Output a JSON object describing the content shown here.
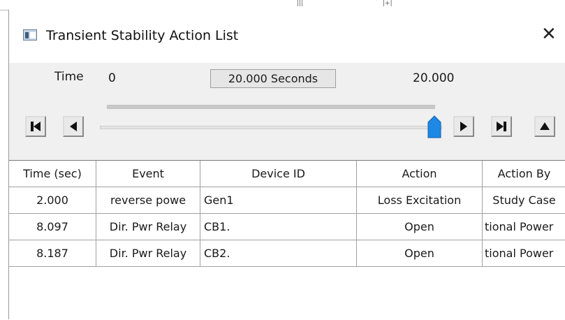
{
  "window": {
    "title": "Transient Stability Action List",
    "close_icon": "close-icon",
    "app_icon": "app-window-icon"
  },
  "time_bar": {
    "label": "Time",
    "start": "0",
    "current": "20.000 Seconds",
    "end": "20.000",
    "progress_fraction": 1.0,
    "slider_fraction": 1.0
  },
  "controls": [
    {
      "name": "first-frame-button",
      "icon": "skip-to-start-icon"
    },
    {
      "name": "step-back-button",
      "icon": "step-back-icon"
    },
    {
      "name": "play-button",
      "icon": "play-icon"
    },
    {
      "name": "last-frame-button",
      "icon": "skip-to-end-icon"
    },
    {
      "name": "eject-button",
      "icon": "eject-icon"
    }
  ],
  "table": {
    "headers": [
      "Time (sec)",
      "Event",
      "Device ID",
      "Action",
      "Action By"
    ],
    "rows": [
      [
        "2.000",
        "reverse powe",
        "Gen1",
        "Loss Excitation",
        "Study Case"
      ],
      [
        "8.097",
        "Dir. Pwr Relay",
        "CB1.",
        "Open",
        "tional Power"
      ],
      [
        "8.187",
        "Dir. Pwr Relay",
        "CB2.",
        "Open",
        "tional Power"
      ]
    ]
  },
  "colors": {
    "slider_thumb": "#1e88e5",
    "window_bg": "#f0f0f0"
  }
}
